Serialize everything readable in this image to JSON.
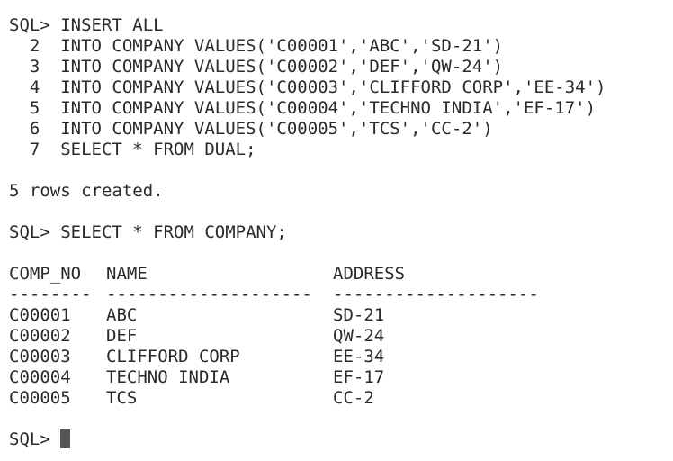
{
  "session": {
    "prompt": "SQL> ",
    "insert_lines": [
      "SQL> INSERT ALL",
      "  2  INTO COMPANY VALUES('C00001','ABC','SD-21')",
      "  3  INTO COMPANY VALUES('C00002','DEF','QW-24')",
      "  4  INTO COMPANY VALUES('C00003','CLIFFORD CORP','EE-34')",
      "  5  INTO COMPANY VALUES('C00004','TECHNO INDIA','EF-17')",
      "  6  INTO COMPANY VALUES('C00005','TCS','CC-2')",
      "  7  SELECT * FROM DUAL;"
    ],
    "insert_result": "5 rows created.",
    "select_command": "SQL> SELECT * FROM COMPANY;",
    "table": {
      "headers": [
        "COMP_NO",
        "NAME",
        "ADDRESS"
      ],
      "separators": [
        "--------",
        "--------------------",
        "--------------------"
      ],
      "rows": [
        [
          "C00001",
          "ABC",
          "SD-21"
        ],
        [
          "C00002",
          "DEF",
          "QW-24"
        ],
        [
          "C00003",
          "CLIFFORD CORP",
          "EE-34"
        ],
        [
          "C00004",
          "TECHNO INDIA",
          "EF-17"
        ],
        [
          "C00005",
          "TCS",
          "CC-2"
        ]
      ]
    },
    "final_prompt": "SQL> "
  }
}
